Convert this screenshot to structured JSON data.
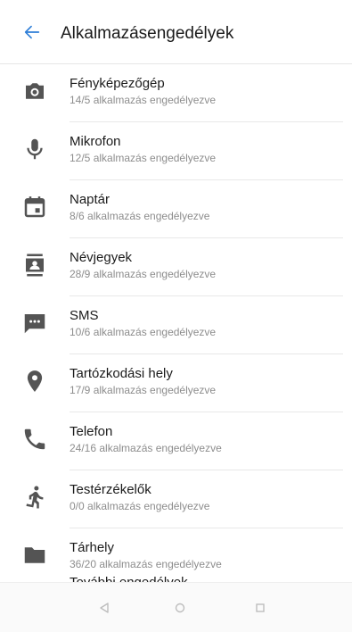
{
  "header": {
    "back_icon": "arrow-left-icon",
    "title": "Alkalmazásengedélyek",
    "accent": "#2f7fd8"
  },
  "permissions": [
    {
      "name": "Fényképezőgép",
      "subtitle": "14/5 alkalmazás engedélyezve",
      "icon": "camera-icon"
    },
    {
      "name": "Mikrofon",
      "subtitle": "12/5 alkalmazás engedélyezve",
      "icon": "microphone-icon"
    },
    {
      "name": "Naptár",
      "subtitle": "8/6 alkalmazás engedélyezve",
      "icon": "calendar-icon"
    },
    {
      "name": "Névjegyek",
      "subtitle": "28/9 alkalmazás engedélyezve",
      "icon": "contacts-icon"
    },
    {
      "name": "SMS",
      "subtitle": "10/6 alkalmazás engedélyezve",
      "icon": "sms-icon"
    },
    {
      "name": "Tartózkodási hely",
      "subtitle": "17/9 alkalmazás engedélyezve",
      "icon": "location-icon"
    },
    {
      "name": "Telefon",
      "subtitle": "24/16 alkalmazás engedélyezve",
      "icon": "phone-icon"
    },
    {
      "name": "Testérzékelők",
      "subtitle": "0/0 alkalmazás engedélyezve",
      "icon": "body-sensors-icon"
    },
    {
      "name": "Tárhely",
      "subtitle": "36/20 alkalmazás engedélyezve",
      "icon": "folder-icon"
    }
  ],
  "partial_item": "További engedélyek",
  "navbar": {
    "back_icon": "nav-back-triangle-icon",
    "home_icon": "nav-home-circle-icon",
    "recents_icon": "nav-recents-square-icon"
  }
}
